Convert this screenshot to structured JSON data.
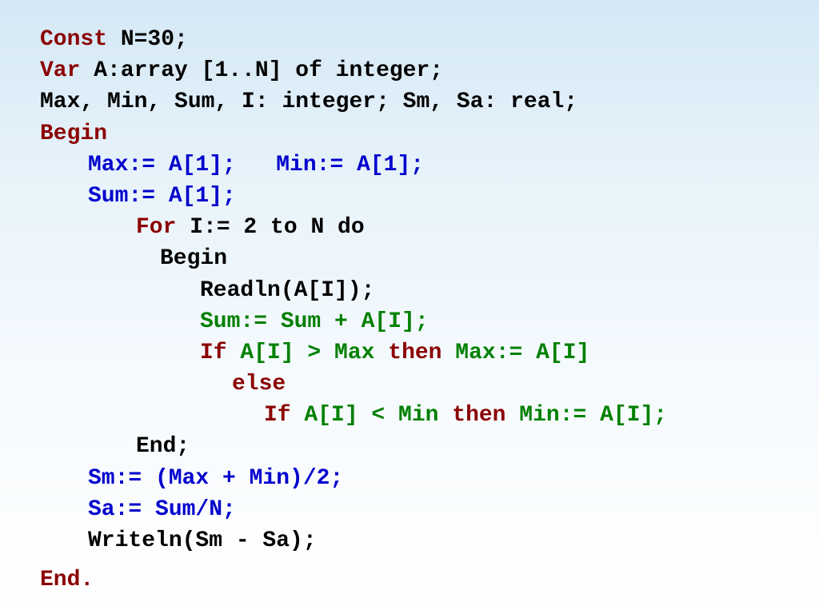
{
  "lines": {
    "l1_const": "Const ",
    "l1_n30": "N=30;",
    "l2_var": "Var ",
    "l2_arr": "A:array [1..N] of integer;",
    "l3": "Max, Min, Sum, I: integer; Sm, Sa: real;",
    "l4_begin": "Begin",
    "l5_max": "Max:= A[1];   ",
    "l5_min": "Min:= A[1];",
    "l6": "Sum:= A[1];",
    "l7_for": "For ",
    "l7_body": "I:= 2 to N do",
    "l8": "Begin",
    "l9": "Readln(A[I]);",
    "l10": "Sum:= Sum + A[I];",
    "l11_if": "If ",
    "l11_cond": "A[I] > Max ",
    "l11_then": "then ",
    "l11_assign": "Max:= A[I]",
    "l12": "else",
    "l13_if": "If ",
    "l13_cond": "A[I] < Min ",
    "l13_then": "then ",
    "l13_assign": "Min:= A[I];",
    "l14": "End;",
    "l15": "Sm:= (Max + Min)/2;",
    "l16": "Sa:= Sum/N;",
    "l17": "Writeln(Sm - Sa);",
    "l18": "End."
  }
}
